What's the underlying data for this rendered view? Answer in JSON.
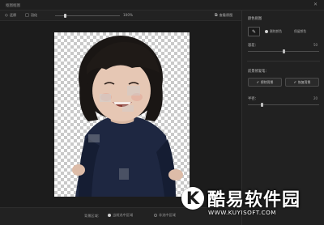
{
  "window": {
    "title": "抠图抠图",
    "close_icon": "close-icon"
  },
  "toolbar": {
    "restore_label": "还原",
    "edge_label": "羽化",
    "zoom_value": "100%",
    "zoom_slider_fraction": 0.16,
    "preview_label": "查看原图",
    "restore_icon": "restore-icon",
    "edge_icon": "feather-icon",
    "preview_icon": "image-compare-icon"
  },
  "panel": {
    "color_pick_label": "颜色抠图",
    "picker_icon": "eyedropper-icon",
    "opt1_label": "删除颜色",
    "opt2_label": "保留颜色",
    "tolerance_label": "容差：",
    "tolerance_value": "50",
    "tolerance_fraction": 0.5,
    "brush_label": "前景修复笔：",
    "btn_erase_label": "擦除背景",
    "btn_restore_label": "恢复背景",
    "brush_size_label": "半径：",
    "brush_size_value": "20",
    "brush_size_fraction": 0.2
  },
  "status": {
    "label": "背景区域：",
    "opt_selected": "当前选中区域",
    "opt_other": "非选中区域"
  },
  "watermark": {
    "logo_letter": "K",
    "text": "酷易软件园",
    "url": "WWW.KUYISOFT.COM"
  }
}
